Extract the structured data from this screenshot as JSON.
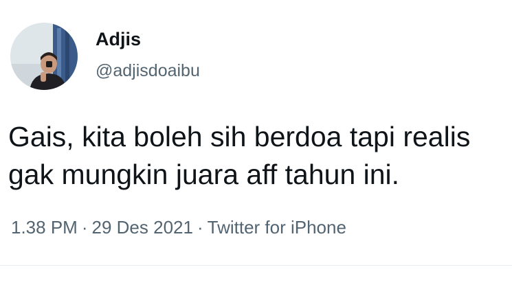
{
  "author": {
    "name": "Adjis",
    "handle": "@adjisdoaibu",
    "avatar_icon": "profile-photo"
  },
  "tweet": {
    "lines": [
      "Gais, kita boleh sih berdoa tapi realis",
      "gak mungkin juara aff tahun ini."
    ]
  },
  "meta": {
    "time": "1.38 PM",
    "separator": "·",
    "date": "29 Des 2021",
    "source": "Twitter for iPhone"
  },
  "colors": {
    "text_primary": "#0f1419",
    "text_secondary": "#536471",
    "divider": "#e6ecf0"
  }
}
